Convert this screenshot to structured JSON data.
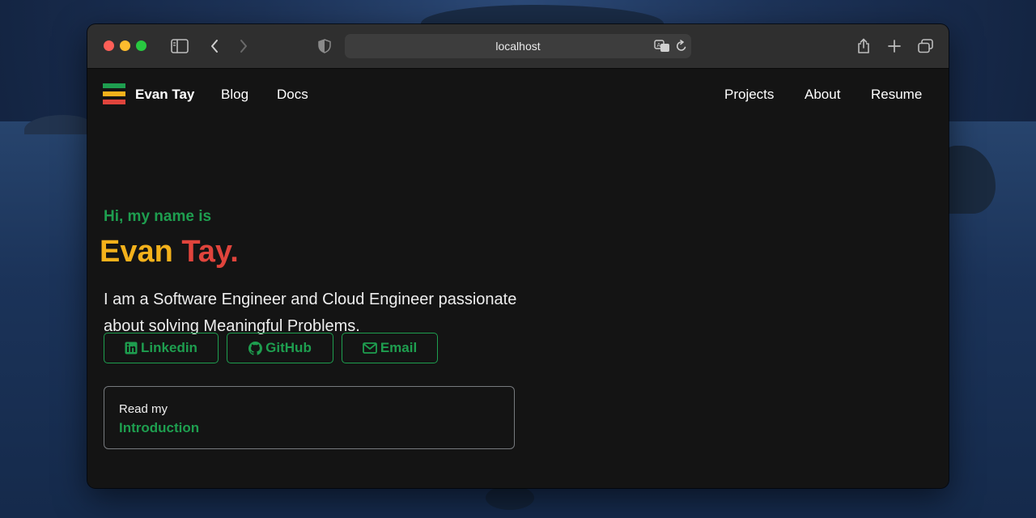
{
  "browser": {
    "address": "localhost"
  },
  "site": {
    "brand": "Evan Tay",
    "nav_left": [
      {
        "label": "Blog"
      },
      {
        "label": "Docs"
      }
    ],
    "nav_right": [
      {
        "label": "Projects"
      },
      {
        "label": "About"
      },
      {
        "label": "Resume"
      }
    ],
    "logo_colors": [
      "#1e9e4f",
      "#f3b11b",
      "#e0443c"
    ]
  },
  "hero": {
    "greeting": "Hi, my name is",
    "first_name": "Evan",
    "last_name": "Tay.",
    "description": "I am a Software Engineer and Cloud Engineer passionate about solving Meaningful Problems.",
    "buttons": [
      {
        "label": "Linkedin",
        "icon": "linkedin-icon"
      },
      {
        "label": "GitHub",
        "icon": "github-icon"
      },
      {
        "label": "Email",
        "icon": "mail-icon"
      }
    ],
    "intro_card": {
      "pre": "Read my",
      "link": "Introduction"
    }
  },
  "colors": {
    "accent_green": "#1e9e4f",
    "accent_yellow": "#f3b11b",
    "accent_red": "#e0443c",
    "background": "#141414"
  }
}
